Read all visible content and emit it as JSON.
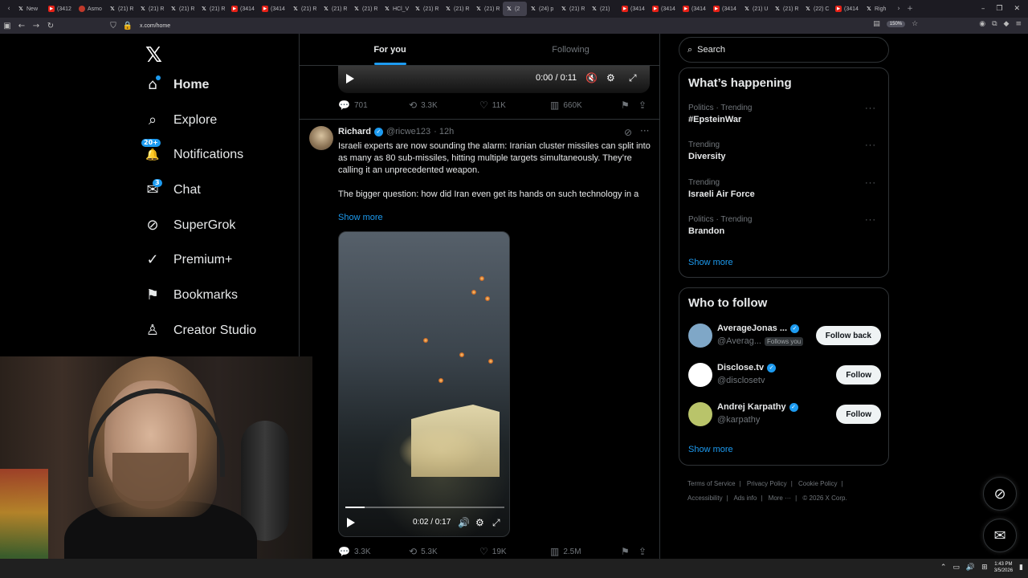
{
  "browser": {
    "tabs": [
      {
        "fav": "x",
        "label": "New"
      },
      {
        "fav": "yt",
        "label": "(3412"
      },
      {
        "fav": "brown",
        "label": "Asmo"
      },
      {
        "fav": "x",
        "label": "(21) R"
      },
      {
        "fav": "x",
        "label": "(21) R"
      },
      {
        "fav": "x",
        "label": "(21) R"
      },
      {
        "fav": "x",
        "label": "(21) R"
      },
      {
        "fav": "yt",
        "label": "(3414"
      },
      {
        "fav": "yt",
        "label": "(3414"
      },
      {
        "fav": "x",
        "label": "(21) R"
      },
      {
        "fav": "x",
        "label": "(21) R"
      },
      {
        "fav": "x",
        "label": "(21) R"
      },
      {
        "fav": "x",
        "label": "HCl_V"
      },
      {
        "fav": "x",
        "label": "(21) R"
      },
      {
        "fav": "x",
        "label": "(21) R"
      },
      {
        "fav": "x",
        "label": "(21) R"
      },
      {
        "fav": "x",
        "label": "(2",
        "active": true
      },
      {
        "fav": "x",
        "label": "(24) p"
      },
      {
        "fav": "x",
        "label": "(21) R"
      },
      {
        "fav": "x",
        "label": "(21)"
      },
      {
        "fav": "yt",
        "label": "(3414"
      },
      {
        "fav": "yt",
        "label": "(3414"
      },
      {
        "fav": "yt",
        "label": "(3414"
      },
      {
        "fav": "yt",
        "label": "(3414"
      },
      {
        "fav": "x",
        "label": "(21) U"
      },
      {
        "fav": "x",
        "label": "(21) R"
      },
      {
        "fav": "x",
        "label": "(22) C"
      },
      {
        "fav": "yt",
        "label": "(3414"
      },
      {
        "fav": "x",
        "label": "Righ"
      }
    ],
    "url": "x.com/home",
    "zoom": "150%"
  },
  "nav": {
    "logo": "𝕏",
    "items": [
      {
        "key": "home",
        "label": "Home",
        "icon": "⌂",
        "icon_name": "home-icon"
      },
      {
        "key": "explore",
        "label": "Explore",
        "icon": "⌕",
        "icon_name": "search-icon"
      },
      {
        "key": "notifications",
        "label": "Notifications",
        "icon": "🔔",
        "icon_name": "bell-icon",
        "badge": "20+"
      },
      {
        "key": "chat",
        "label": "Chat",
        "icon": "✉",
        "icon_name": "mail-icon",
        "badge": "3"
      },
      {
        "key": "supergrok",
        "label": "SuperGrok",
        "icon": "⊘",
        "icon_name": "grok-icon"
      },
      {
        "key": "premium",
        "label": "Premium+",
        "icon": "✓",
        "icon_name": "verified-icon"
      },
      {
        "key": "bookmarks",
        "label": "Bookmarks",
        "icon": "⚑",
        "icon_name": "bookmark-icon"
      },
      {
        "key": "creator",
        "label": "Creator Studio",
        "icon": "♙",
        "icon_name": "creator-icon"
      }
    ]
  },
  "feed": {
    "tabs": [
      "For you",
      "Following"
    ],
    "top_video": {
      "time": "0:00 / 0:11",
      "progress": 0
    },
    "top_actions": {
      "replies": "701",
      "reposts": "3.3K",
      "likes": "11K",
      "views": "660K"
    },
    "tweet": {
      "name": "Richard",
      "handle": "@ricwe123",
      "time": "· 12h",
      "text1": "Israeli experts are now sounding the alarm: Iranian cluster missiles can split into as many as 80 sub-missiles, hitting multiple targets simultaneously. They’re calling it an unprecedented weapon.",
      "text2": "The bigger question: how did Iran even get its hands on such technology in a",
      "show_more": "Show more",
      "video_time": "0:02 / 0:17",
      "video_progress": 0.12,
      "replies": "3.3K",
      "reposts": "5.3K",
      "likes": "19K",
      "views": "2.5M"
    }
  },
  "sidebar": {
    "search_placeholder": "Search",
    "happening_title": "What’s happening",
    "trends": [
      {
        "meta": "Politics · Trending",
        "topic": "#EpsteinWar"
      },
      {
        "meta": "Trending",
        "topic": "Diversity"
      },
      {
        "meta": "Trending",
        "topic": "Israeli Air Force"
      },
      {
        "meta": "Politics · Trending",
        "topic": "Brandon"
      }
    ],
    "show_more": "Show more",
    "wtf_title": "Who to follow",
    "accounts": [
      {
        "name": "AverageJonas ...",
        "handle": "@Averag...",
        "follows_you": "Follows you",
        "button": "Follow back",
        "color": "#7fa7c7"
      },
      {
        "name": "Disclose.tv",
        "handle": "@disclosetv",
        "button": "Follow",
        "color": "#ffffff"
      },
      {
        "name": "Andrej Karpathy",
        "handle": "@karpathy",
        "button": "Follow",
        "color": "#b9c46a"
      }
    ],
    "wtf_show_more": "Show more",
    "footer": [
      "Terms of Service",
      "Privacy Policy",
      "Cookie Policy",
      "Accessibility",
      "Ads info",
      "More ···",
      "© 2026 X Corp."
    ]
  },
  "taskbar": {
    "time": "1:43 PM",
    "date": "3/5/2026"
  },
  "colors": {
    "accent": "#1d9bf0",
    "bg": "#000000",
    "border": "#2f3336",
    "muted": "#71767b"
  }
}
